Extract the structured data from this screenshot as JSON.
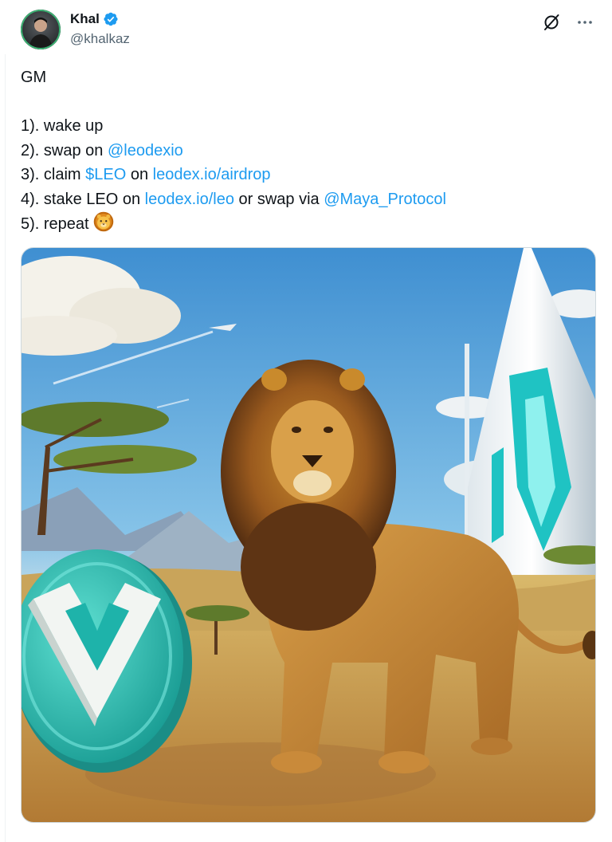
{
  "author": {
    "display_name": "Khal",
    "handle": "@khalkaz",
    "verified": true,
    "verified_color": "#1d9bf0",
    "avatar_icon": "profile-photo"
  },
  "header_actions": {
    "grok_icon": "grok-icon",
    "more_icon": "more-icon"
  },
  "tweet": {
    "line_gm": "GM",
    "line1": "1). wake up",
    "line2_prefix": "2). swap on ",
    "line2_link": "@leodexio",
    "line3_prefix": "3). claim ",
    "line3_cashtag": "$LEO",
    "line3_mid": " on ",
    "line3_link": "leodex.io/airdrop",
    "line4_prefix": "4). stake LEO on ",
    "line4_link1": "leodex.io/leo",
    "line4_mid": " or swap via ",
    "line4_link2": "@Maya_Protocol",
    "line5_prefix": "5). repeat ",
    "line5_emoji": "lion-face-emoji"
  },
  "media": {
    "type": "image",
    "icon": "leo-coin-icon"
  },
  "colors": {
    "link": "#1d9bf0",
    "text": "#0f1419",
    "secondary": "#536471",
    "coin_teal": "#2ec4b6"
  }
}
